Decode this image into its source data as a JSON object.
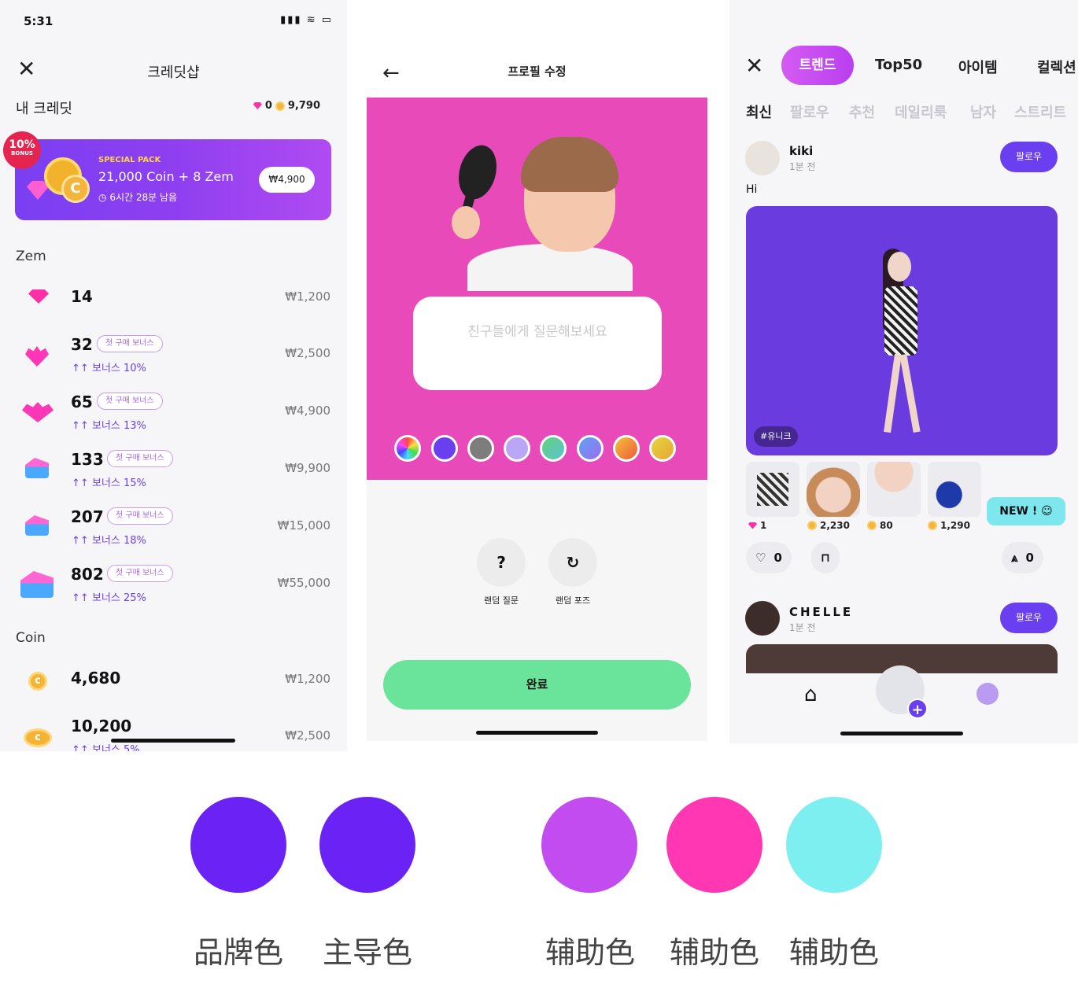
{
  "screen1": {
    "status_time": "5:31",
    "status_icons": "signal wifi battery",
    "title": "크레딧샵",
    "my_credit_label": "내 크레딧",
    "balance": {
      "zem": "0",
      "coin": "9,790"
    },
    "promo": {
      "badge_pct": "10%",
      "badge_label": "BONUS",
      "label": "SPECIAL PACK",
      "title": "21,000 Coin + 8 Zem",
      "time_left": "6시간 28분 남음",
      "price": "₩4,900"
    },
    "zem_section": "Zem",
    "zem_items": [
      {
        "amount": "14",
        "first_bonus": "",
        "bonus": "",
        "price": "₩1,200"
      },
      {
        "amount": "32",
        "first_bonus": "첫 구매 보너스",
        "bonus": "보너스 10%",
        "price": "₩2,500"
      },
      {
        "amount": "65",
        "first_bonus": "첫 구매 보너스",
        "bonus": "보너스 13%",
        "price": "₩4,900"
      },
      {
        "amount": "133",
        "first_bonus": "첫 구매 보너스",
        "bonus": "보너스 15%",
        "price": "₩9,900"
      },
      {
        "amount": "207",
        "first_bonus": "첫 구매 보너스",
        "bonus": "보너스 18%",
        "price": "₩15,000"
      },
      {
        "amount": "802",
        "first_bonus": "첫 구매 보너스",
        "bonus": "보너스 25%",
        "price": "₩55,000"
      }
    ],
    "coin_section": "Coin",
    "coin_items": [
      {
        "amount": "4,680",
        "bonus": "",
        "price": "₩1,200"
      },
      {
        "amount": "10,200",
        "bonus": "보너스 5%",
        "price": "₩2,500"
      }
    ],
    "bonus_arrow": "↑↑"
  },
  "screen2": {
    "title": "프로필 수정",
    "question_placeholder": "친구들에게 질문해보세요",
    "swatches": [
      "rainbow",
      "#6a3ff0",
      "#7d7d7d",
      "#b9a7f5",
      "#5fd2a3",
      "#7b7df2",
      "#f08a3a",
      "#e6c53a"
    ],
    "random_question_icon": "?",
    "random_question_label": "랜덤 질문",
    "random_pose_icon": "↻",
    "random_pose_label": "랜덤 포즈",
    "done_label": "완료"
  },
  "screen3": {
    "top_tabs": [
      "트렌드",
      "Top50",
      "아이템",
      "컬렉션"
    ],
    "sub_tabs": [
      "최신",
      "팔로우",
      "추천",
      "데일리룩",
      "남자",
      "스트리트"
    ],
    "post1": {
      "user": "kiki",
      "time": "1분 전",
      "follow": "팔로우",
      "text": "Hi",
      "tag": "#유니크",
      "item_prices": [
        {
          "currency": "zem",
          "value": "1"
        },
        {
          "currency": "coin",
          "value": "2,230"
        },
        {
          "currency": "coin",
          "value": "80"
        },
        {
          "currency": "coin",
          "value": "1,290"
        }
      ],
      "new_tip": "NEW !",
      "likes": "0",
      "wears": "0"
    },
    "post2": {
      "user": "CHELLE",
      "time": "1분 전",
      "follow": "팔로우"
    },
    "tab_plus": "+"
  },
  "palette": [
    {
      "label": "品牌色",
      "color": "#6b22f5"
    },
    {
      "label": "主导色",
      "color": "#6b22f5"
    },
    {
      "label": "辅助色",
      "color": "#c24cf0"
    },
    {
      "label": "辅助色",
      "color": "#ff37b3"
    },
    {
      "label": "辅助色",
      "color": "#7eeff1"
    }
  ]
}
